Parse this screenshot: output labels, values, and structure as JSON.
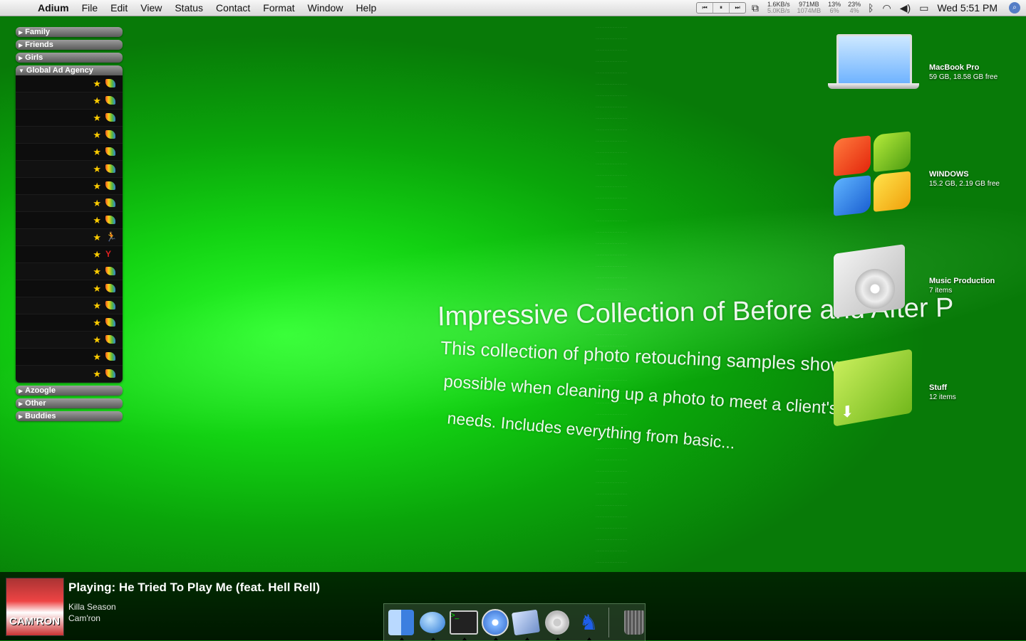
{
  "menubar": {
    "apple_icon": "apple-icon",
    "app_name": "Adium",
    "menus": [
      "File",
      "Edit",
      "View",
      "Status",
      "Contact",
      "Format",
      "Window",
      "Help"
    ],
    "media_controls": [
      "⏮",
      "⏸",
      "⏭"
    ],
    "net_up": "1.6KB/s",
    "net_down": "5.0KB/s",
    "mem_top": "971MB",
    "mem_bottom": "1074MB",
    "cpu1_top": "13%",
    "cpu1_bottom": "6%",
    "cpu2_top": "23%",
    "cpu2_bottom": "4%",
    "clock": "Wed 5:51 PM"
  },
  "adium": {
    "groups_top": [
      {
        "label": "Family"
      },
      {
        "label": "Friends"
      },
      {
        "label": "Girls"
      }
    ],
    "expanded_group": "Global Ad Agency",
    "contacts": [
      {
        "status": "msn"
      },
      {
        "status": "msn"
      },
      {
        "status": "msn"
      },
      {
        "status": "msn"
      },
      {
        "status": "msn"
      },
      {
        "status": "msn"
      },
      {
        "status": "msn"
      },
      {
        "status": "msn"
      },
      {
        "status": "msn"
      },
      {
        "status": "running"
      },
      {
        "status": "away"
      },
      {
        "status": "msn"
      },
      {
        "status": "msn"
      },
      {
        "status": "msn"
      },
      {
        "status": "msn"
      },
      {
        "status": "msn"
      },
      {
        "status": "msn"
      },
      {
        "status": "msn"
      }
    ],
    "groups_bottom": [
      {
        "label": "Azoogle"
      },
      {
        "label": "Other"
      },
      {
        "label": "Buddies"
      }
    ]
  },
  "desktop_text": {
    "headline": "Impressive Collection of Before and After P",
    "line1": "This collection of photo retouching samples shows what's",
    "line2": "possible when cleaning up a photo to meet a client's",
    "line3": "needs. Includes everything from basic..."
  },
  "desktop_icons": [
    {
      "name": "MacBook Pro",
      "detail": "59 GB, 18.58 GB free"
    },
    {
      "name": "WINDOWS",
      "detail": "15.2 GB, 2.19 GB free"
    },
    {
      "name": "Music Production",
      "detail": "7 items"
    },
    {
      "name": "Stuff",
      "detail": "12 items"
    }
  ],
  "now_playing": {
    "title": "Playing: He Tried To Play Me (feat. Hell Rell)",
    "album": "Killa Season",
    "artist": "Cam'ron",
    "cover_text": "CAM'RON"
  },
  "dock": [
    "Finder",
    "iChat",
    "Terminal",
    "Safari",
    "Mail",
    "iTunes",
    "Adium",
    "Trash"
  ]
}
